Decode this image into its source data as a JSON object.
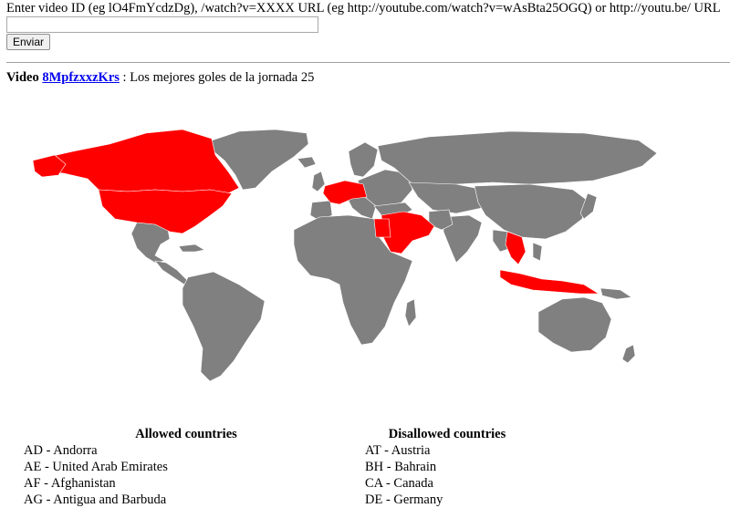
{
  "form": {
    "prompt": "Enter video ID (eg lO4FmYcdzDg), /watch?v=XXXX URL (eg http://youtube.com/watch?v=wAsBta25OGQ) or http://youtu.be/ URL",
    "input_value": "",
    "submit_label": "Enviar"
  },
  "video": {
    "label": "Video",
    "id": "8MpfzxxzKrs",
    "separator": ":",
    "title": "Los mejores goles de la jornada 25"
  },
  "map": {
    "colors": {
      "allowed": "#808080",
      "disallowed": "#ff0000",
      "border": "#ffffff"
    }
  },
  "allowed": {
    "heading": "Allowed countries",
    "items": [
      "AD - Andorra",
      "AE - United Arab Emirates",
      "AF - Afghanistan",
      "AG - Antigua and Barbuda"
    ]
  },
  "disallowed": {
    "heading": "Disallowed countries",
    "items": [
      "AT - Austria",
      "BH - Bahrain",
      "CA - Canada",
      "DE - Germany"
    ]
  }
}
